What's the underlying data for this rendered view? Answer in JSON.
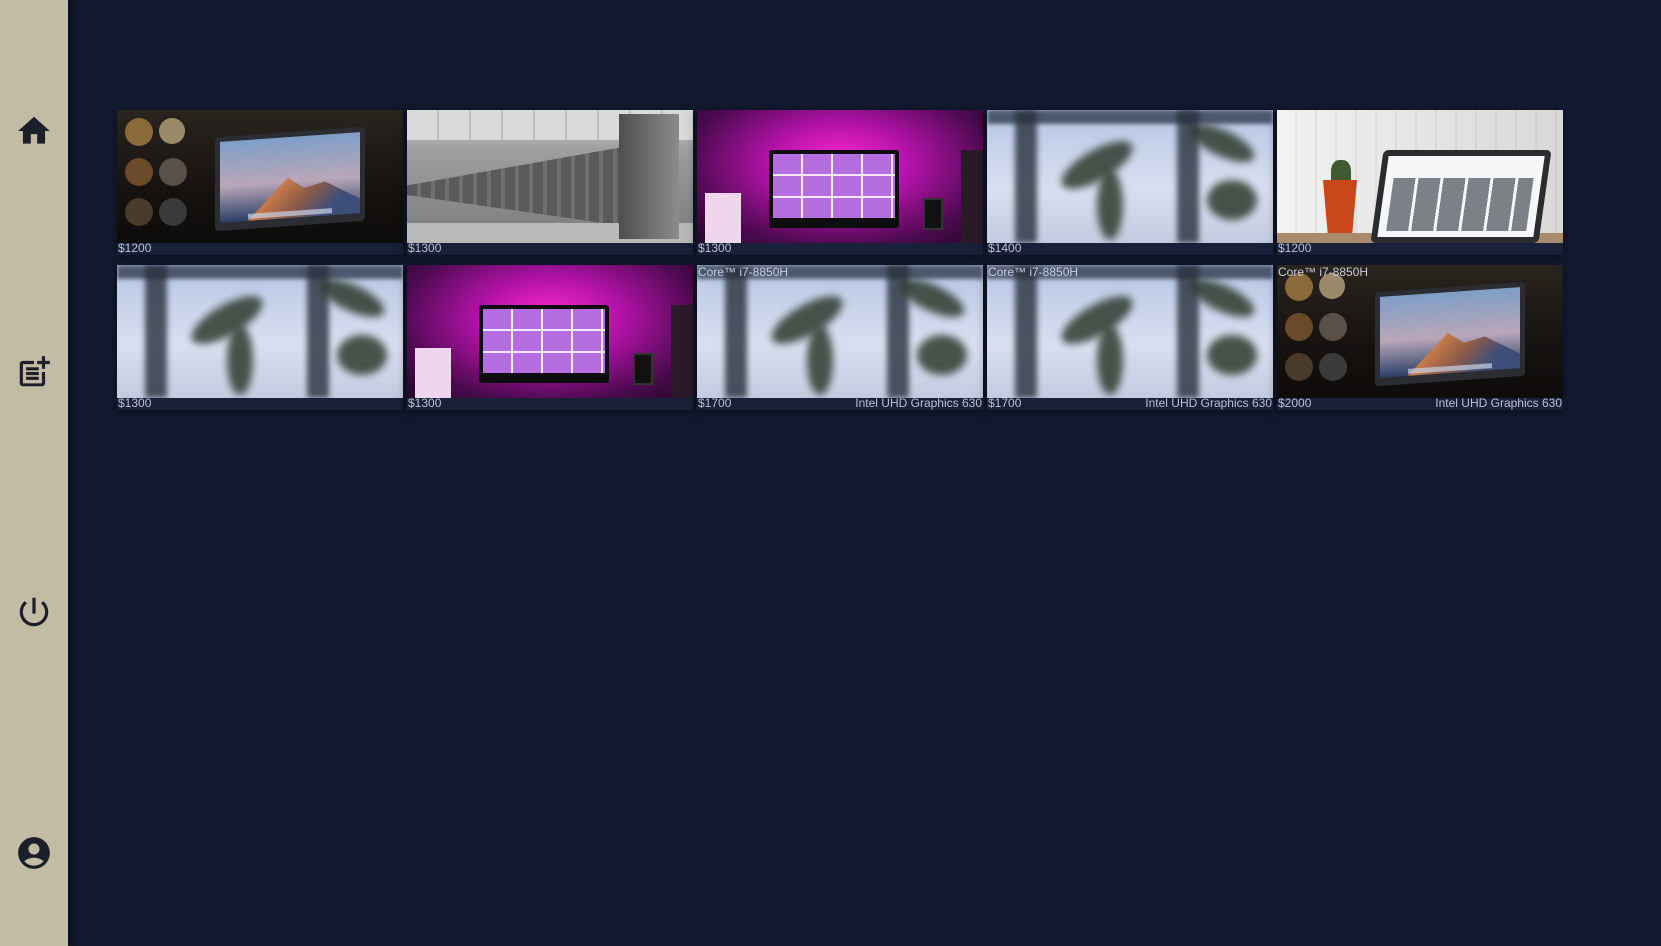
{
  "sidebar": {
    "items": [
      {
        "name": "home",
        "icon": "home-icon"
      },
      {
        "name": "post-add",
        "icon": "post-add-icon"
      },
      {
        "name": "power",
        "icon": "power-icon"
      },
      {
        "name": "account",
        "icon": "account-circle-icon"
      }
    ]
  },
  "products": [
    {
      "price": "$1200",
      "image": "laptop-mountain"
    },
    {
      "price": "$1300",
      "image": "server-room"
    },
    {
      "price": "$1300",
      "image": "pink-desk"
    },
    {
      "price": "$1400",
      "image": "palm-window"
    },
    {
      "price": "$1200",
      "image": "cactus-laptop"
    },
    {
      "price": "$1300",
      "image": "palm-window"
    },
    {
      "price": "$1300",
      "image": "pink-desk"
    },
    {
      "price": "$1700",
      "image": "palm-window",
      "cpu": "Core™ i7-8850H",
      "gpu": "Intel UHD Graphics 630"
    },
    {
      "price": "$1700",
      "image": "palm-window",
      "cpu": "Core™ i7-8850H",
      "gpu": "Intel UHD Graphics 630"
    },
    {
      "price": "$2000",
      "image": "laptop-mountain",
      "cpu": "Core™ i7-8850H",
      "gpu": "Intel UHD Graphics 630"
    }
  ],
  "colors": {
    "background": "#131a30",
    "sidebar": "#c2bca4",
    "card": "#182139",
    "caption_text": "#b9c1d2"
  }
}
